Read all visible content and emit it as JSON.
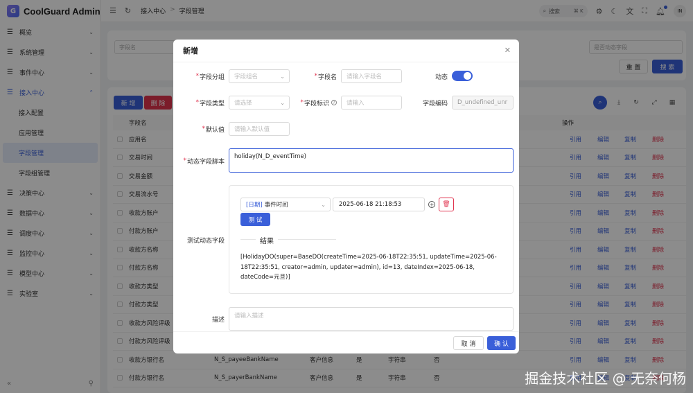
{
  "app": {
    "title": "CoolGuard Admin",
    "logo_letter": "G"
  },
  "sidebar": {
    "items": [
      {
        "label": "概览"
      },
      {
        "label": "系统管理"
      },
      {
        "label": "事件中心"
      },
      {
        "label": "接入中心",
        "active": true
      },
      {
        "label": "决策中心"
      },
      {
        "label": "数据中心"
      },
      {
        "label": "调度中心"
      },
      {
        "label": "监控中心"
      },
      {
        "label": "模型中心"
      },
      {
        "label": "实验室"
      }
    ],
    "sub_items": [
      {
        "label": "接入配置"
      },
      {
        "label": "应用管理"
      },
      {
        "label": "字段管理",
        "active": true
      },
      {
        "label": "字段组管理"
      }
    ]
  },
  "topbar": {
    "breadcrumb": [
      "接入中心",
      "字段管理"
    ],
    "search_label": "搜索",
    "search_shortcut": "⌘ K",
    "user_initials": "IN"
  },
  "background": {
    "filters": {
      "field_name_placeholder": "字段名",
      "dynamic_placeholder": "是否动态字段"
    },
    "buttons": {
      "reset": "重 置",
      "search": "搜 索",
      "add": "新 增",
      "delete": "删 除"
    },
    "table": {
      "headers": {
        "name": "字段名",
        "ops": "操作"
      },
      "actions": {
        "ref": "引用",
        "edit": "编辑",
        "copy": "复制",
        "delete": "删除"
      },
      "rows": [
        {
          "name": "应用名",
          "code": "",
          "group": "",
          "required": "",
          "type": "",
          "dynamic": ""
        },
        {
          "name": "交易时间",
          "code": "",
          "group": "",
          "required": "",
          "type": "",
          "dynamic": ""
        },
        {
          "name": "交易金额",
          "code": "",
          "group": "",
          "required": "",
          "type": "",
          "dynamic": ""
        },
        {
          "name": "交易流水号",
          "code": "",
          "group": "",
          "required": "",
          "type": "",
          "dynamic": ""
        },
        {
          "name": "收款方账户",
          "code": "",
          "group": "",
          "required": "",
          "type": "",
          "dynamic": ""
        },
        {
          "name": "付款方账户",
          "code": "",
          "group": "",
          "required": "",
          "type": "",
          "dynamic": ""
        },
        {
          "name": "收款方名称",
          "code": "",
          "group": "",
          "required": "",
          "type": "",
          "dynamic": ""
        },
        {
          "name": "付款方名称",
          "code": "",
          "group": "",
          "required": "",
          "type": "",
          "dynamic": ""
        },
        {
          "name": "收款方类型",
          "code": "",
          "group": "",
          "required": "",
          "type": "",
          "dynamic": ""
        },
        {
          "name": "付款方类型",
          "code": "",
          "group": "",
          "required": "",
          "type": "",
          "dynamic": ""
        },
        {
          "name": "收款方风险评级",
          "code": "",
          "group": "",
          "required": "",
          "type": "",
          "dynamic": ""
        },
        {
          "name": "付款方风险评级",
          "code": "",
          "group": "",
          "required": "",
          "type": "",
          "dynamic": ""
        },
        {
          "name": "收款方银行名",
          "code": "N_S_payeeBankName",
          "group": "客户信息",
          "required": "是",
          "type": "字符串",
          "dynamic": "否"
        },
        {
          "name": "付款方银行名",
          "code": "N_S_payerBankName",
          "group": "客户信息",
          "required": "是",
          "type": "字符串",
          "dynamic": "否"
        }
      ]
    }
  },
  "modal": {
    "title": "新增",
    "fields": {
      "group_label": "字段分组",
      "group_placeholder": "字段组名",
      "name_label": "字段名",
      "name_placeholder": "请输入字段名",
      "dynamic_label": "动态",
      "type_label": "字段类型",
      "type_placeholder": "请选择",
      "identifier_label": "字段标识",
      "identifier_placeholder": "请输入",
      "code_label": "字段编码",
      "code_value": "D_undefined_unr",
      "default_label": "默认值",
      "default_placeholder": "请输入默认值",
      "script_label": "动态字段脚本",
      "script_value": "holiday(N_D_eventTime)",
      "test_label": "测试动态字段",
      "desc_label": "描述",
      "desc_placeholder": "请输入描述"
    },
    "test": {
      "select_tag": "[日期]",
      "select_value": "事件时间",
      "date_value": "2025-06-18 21:18:53",
      "button": "测 试",
      "result_label": "结果",
      "result_text": "[HolidayDO(super=BaseDO(createTime=2025-06-18T22:35:51, updateTime=2025-06-18T22:35:51, creator=admin, updater=admin), id=13, dateIndex=2025-06-18, dateCode=元旦)]"
    },
    "footer": {
      "cancel": "取 消",
      "ok": "确 认"
    }
  },
  "watermark": "掘金技术社区 @ 无奈何杨",
  "colors": {
    "primary": "#3a5fd9",
    "danger": "#e0334e"
  }
}
